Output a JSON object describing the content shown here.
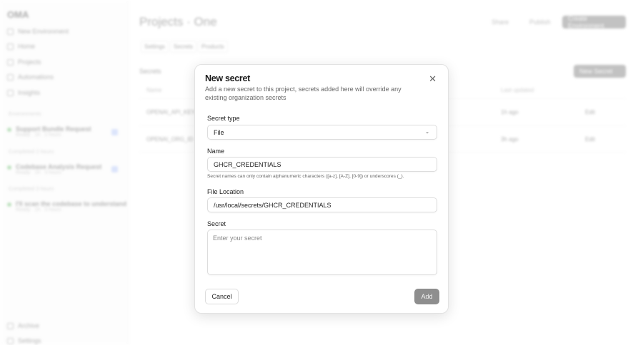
{
  "sidebar": {
    "logo": "OMA",
    "items": [
      {
        "label": "New Environment"
      },
      {
        "label": "Home"
      },
      {
        "label": "Projects"
      },
      {
        "label": "Automations"
      },
      {
        "label": "Insights"
      }
    ],
    "groups": [
      {
        "label": "Environments",
        "env": {
          "title": "Support Bundle Request",
          "sub": "Ready · 1h · 2 hours"
        }
      },
      {
        "label": "Completed 2 hours",
        "env": {
          "title": "Codebase Analysis Request",
          "sub": "Ready · 1h · 3 hours"
        }
      },
      {
        "label": "Completed 3 hours",
        "env": {
          "title": "I'll scan the codebase to understand",
          "sub": "Ready · 1h · 5 hours"
        }
      }
    ],
    "bottom": [
      {
        "label": "Archive"
      },
      {
        "label": "Settings"
      }
    ]
  },
  "header": {
    "title": "Projects · One",
    "share": "Share",
    "publish": "Publish",
    "create": "Create Environment"
  },
  "tabs": [
    "Settings",
    "Secrets",
    "Products"
  ],
  "secrets": {
    "title": "Secrets",
    "new_button": "New Secret",
    "columns": {
      "name": "Name",
      "updated": "Last updated"
    },
    "rows": [
      {
        "name": "OPENAI_API_KEY",
        "updated": "1h ago",
        "edit": "Edit"
      },
      {
        "name": "OPENAI_ORG_ID",
        "updated": "3h ago",
        "edit": "Edit"
      }
    ]
  },
  "modal": {
    "title": "New secret",
    "description": "Add a new secret to this project, secrets added here will override any existing organization secrets",
    "type_label": "Secret type",
    "type_value": "File",
    "name_label": "Name",
    "name_value": "GHCR_CREDENTIALS",
    "name_hint": "Secret names can only contain alphanumeric characters ([a-z], [A-Z], [0-9]) or underscores (_).",
    "location_label": "File Location",
    "location_value": "/usr/local/secrets/GHCR_CREDENTIALS",
    "secret_label": "Secret",
    "secret_placeholder": "Enter your secret",
    "cancel": "Cancel",
    "add": "Add"
  }
}
